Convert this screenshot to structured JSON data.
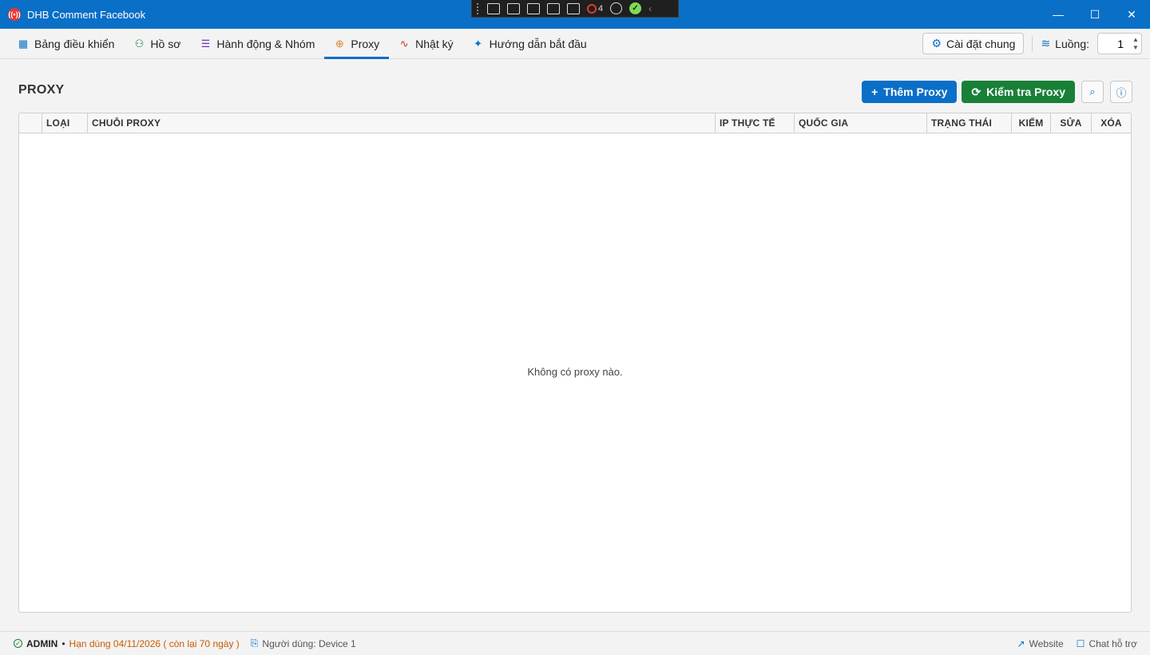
{
  "window": {
    "title": "DHB Comment Facebook",
    "minimize_glyph": "—",
    "maximize_glyph": "☐",
    "close_glyph": "✕"
  },
  "devbar": {
    "counter": "4",
    "ok_glyph": "✓",
    "collapse_glyph": "‹"
  },
  "nav": {
    "tabs": [
      {
        "label": "Bảng điều khiển",
        "icon": "grid-icon",
        "glyph": "▦",
        "color": "#0a6fc7"
      },
      {
        "label": "Hồ sơ",
        "icon": "users-icon",
        "glyph": "⚇",
        "color": "#198038"
      },
      {
        "label": "Hành động & Nhóm",
        "icon": "checklist-icon",
        "glyph": "☰",
        "color": "#7b2fbf"
      },
      {
        "label": "Proxy",
        "icon": "globe-icon",
        "glyph": "⊕",
        "color": "#d9822b"
      },
      {
        "label": "Nhật ký",
        "icon": "activity-icon",
        "glyph": "∿",
        "color": "#d32f2f"
      },
      {
        "label": "Hướng dẫn bắt đầu",
        "icon": "sparkles-icon",
        "glyph": "✦",
        "color": "#0a6fc7"
      }
    ],
    "settings_label": "Cài đặt chung",
    "settings_glyph": "⚙",
    "threads_label": "Luồng:",
    "threads_glyph": "≋",
    "threads_value": "1",
    "spin_up": "▲",
    "spin_down": "▼"
  },
  "page": {
    "title": "PROXY",
    "add_label": "Thêm Proxy",
    "add_glyph": "+",
    "check_label": "Kiểm tra Proxy",
    "check_glyph": "⟳",
    "search_glyph": "⌕",
    "info_glyph": "ⓘ"
  },
  "table": {
    "columns": [
      "",
      "LOẠI",
      "CHUỖI PROXY",
      "IP THỰC TẾ",
      "QUỐC GIA",
      "TRẠNG THÁI",
      "KIỂM",
      "SỬA",
      "XÓA"
    ],
    "rows": [],
    "empty_text": "Không có proxy nào."
  },
  "status": {
    "ok_glyph": "✓",
    "role": "ADMIN",
    "bullet": "•",
    "expiry": "Hạn dùng 04/11/2026 ( còn lại 70 ngày )",
    "user_glyph": "⎘",
    "user": "Người dùng: Device 1",
    "website_glyph": "↗",
    "website_label": "Website",
    "chat_glyph": "☐",
    "chat_label": "Chat hỗ trợ"
  },
  "colors": {
    "accent": "#0a6fc7",
    "success": "#198038",
    "warning": "#c65d00"
  }
}
